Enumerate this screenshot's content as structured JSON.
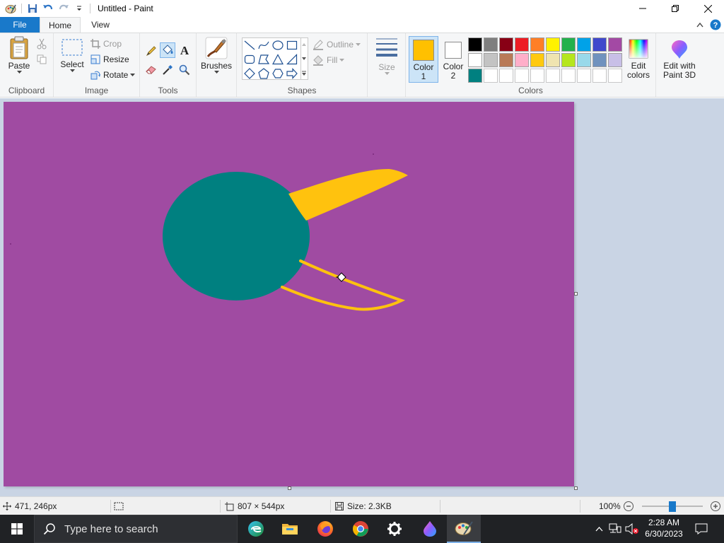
{
  "window": {
    "title": "Untitled - Paint"
  },
  "tabs": {
    "file": "File",
    "home": "Home",
    "view": "View"
  },
  "clipboard": {
    "paste": "Paste",
    "label": "Clipboard"
  },
  "image": {
    "select": "Select",
    "crop": "Crop",
    "resize": "Resize",
    "rotate": "Rotate",
    "label": "Image"
  },
  "tools": {
    "label": "Tools",
    "text_glyph": "A"
  },
  "brushes": {
    "label": "Brushes"
  },
  "shapes": {
    "outline": "Outline",
    "fill": "Fill",
    "label": "Shapes"
  },
  "size": {
    "label": "Size"
  },
  "colors": {
    "color1_label": "Color 1",
    "color1_line1": "Color",
    "color1_line2": "1",
    "color2_line1": "Color",
    "color2_line2": "2",
    "color1_value": "#ffc000",
    "color2_value": "#ffffff",
    "edit_line1": "Edit",
    "edit_line2": "colors",
    "label": "Colors",
    "palette_row1": [
      "#000000",
      "#7f7f7f",
      "#880015",
      "#ed1c24",
      "#ff7f27",
      "#fff200",
      "#22b14c",
      "#00a2e8",
      "#3f48cc",
      "#a349a4"
    ],
    "palette_row2": [
      "#ffffff",
      "#c3c3c3",
      "#b97a57",
      "#ffaec9",
      "#ffc90e",
      "#efe4b0",
      "#b5e61d",
      "#99d9ea",
      "#7092be",
      "#c8bfe7"
    ],
    "palette_row3": [
      "#008080",
      "#ffffff",
      "#ffffff",
      "#ffffff",
      "#ffffff",
      "#ffffff",
      "#ffffff",
      "#ffffff",
      "#ffffff",
      "#ffffff"
    ]
  },
  "paint3d": {
    "line1": "Edit with",
    "line2": "Paint 3D"
  },
  "canvas": {
    "background": "#a04ba2",
    "ellipse_color": "#008080",
    "stroke_color": "#ffc20e"
  },
  "status": {
    "cursor_pos": "471, 246px",
    "dimensions": "807 × 544px",
    "size": "Size: 2.3KB",
    "zoom": "100%"
  },
  "taskbar": {
    "search_placeholder": "Type here to search",
    "time": "2:28 AM",
    "date": "6/30/2023"
  }
}
